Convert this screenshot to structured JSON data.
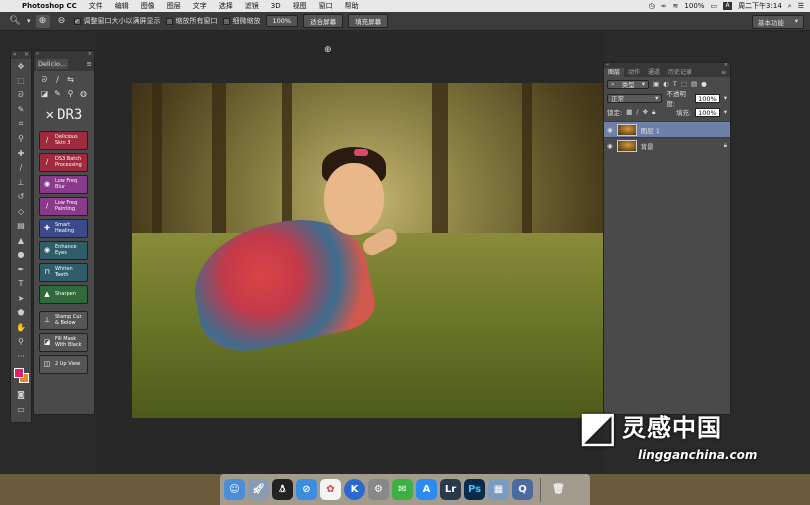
{
  "menubar": {
    "app_name": "Photoshop CC",
    "items": [
      "文件",
      "编辑",
      "图像",
      "图层",
      "文字",
      "选择",
      "滤镜",
      "3D",
      "视图",
      "窗口",
      "帮助"
    ],
    "battery": "100%",
    "input_badge": "A",
    "clock": "周二下午3:14"
  },
  "optionsbar": {
    "resize_windows_label": "调整窗口大小以满屏显示",
    "zoom_all_label": "缩放所有窗口",
    "scrubby_zoom_label": "细微缩放",
    "zoom_100": "100%",
    "fit_screen": "适合屏幕",
    "fill_screen": "填充屏幕",
    "workspace": "基本功能"
  },
  "delicious_panel": {
    "title": "Delicio...",
    "logo_text": "DR3",
    "actions": [
      {
        "label_1": "Delicious",
        "label_2": "Skin 3",
        "color": "#9e2b3e",
        "icon": "brush-icon"
      },
      {
        "label_1": "DS3 Batch",
        "label_2": "Processing",
        "color": "#9e2b3e",
        "icon": "brush-icon"
      },
      {
        "label_1": "Low Freq",
        "label_2": "Blur",
        "color": "#8a3a8a",
        "icon": "eye-icon"
      },
      {
        "label_1": "Low Freq",
        "label_2": "Painting",
        "color": "#8a3a8a",
        "icon": "brush-icon"
      },
      {
        "label_1": "Smart",
        "label_2": "Healing",
        "color": "#3a4a8a",
        "icon": "bandage-icon"
      },
      {
        "label_1": "Enhance",
        "label_2": "Eyes",
        "color": "#2f5d6a",
        "icon": "eye-icon"
      },
      {
        "label_1": "Whiten",
        "label_2": "Teeth",
        "color": "#2f5d6a",
        "icon": "tooth-icon"
      },
      {
        "label_1": "Sharpen",
        "label_2": "",
        "color": "#2f6a3a",
        "icon": "triangle-icon"
      },
      {
        "label_1": "Stamp Cur.",
        "label_2": "& Below",
        "color": "#555555",
        "icon": "stamp-icon"
      },
      {
        "label_1": "Fill Mask",
        "label_2": "With Black",
        "color": "#555555",
        "icon": "mask-icon"
      },
      {
        "label_1": "2 Up View",
        "label_2": "",
        "color": "#555555",
        "icon": "split-view-icon"
      }
    ]
  },
  "layers_panel": {
    "tabs": [
      "图层",
      "动作",
      "通道",
      "历史记录"
    ],
    "filter_kind": "类型",
    "blend_mode": "正常",
    "opacity_label": "不透明度:",
    "opacity_value": "100%",
    "lock_label": "锁定:",
    "fill_label": "填充:",
    "fill_value": "100%",
    "layers": [
      {
        "name": "图层 1",
        "selected": true,
        "locked": false
      },
      {
        "name": "背景",
        "selected": false,
        "locked": true
      }
    ]
  },
  "watermark": {
    "title": "灵感中国",
    "url": "lingganchina.com"
  },
  "colors": {
    "foreground": "#e0206f",
    "background": "#f0842c"
  }
}
